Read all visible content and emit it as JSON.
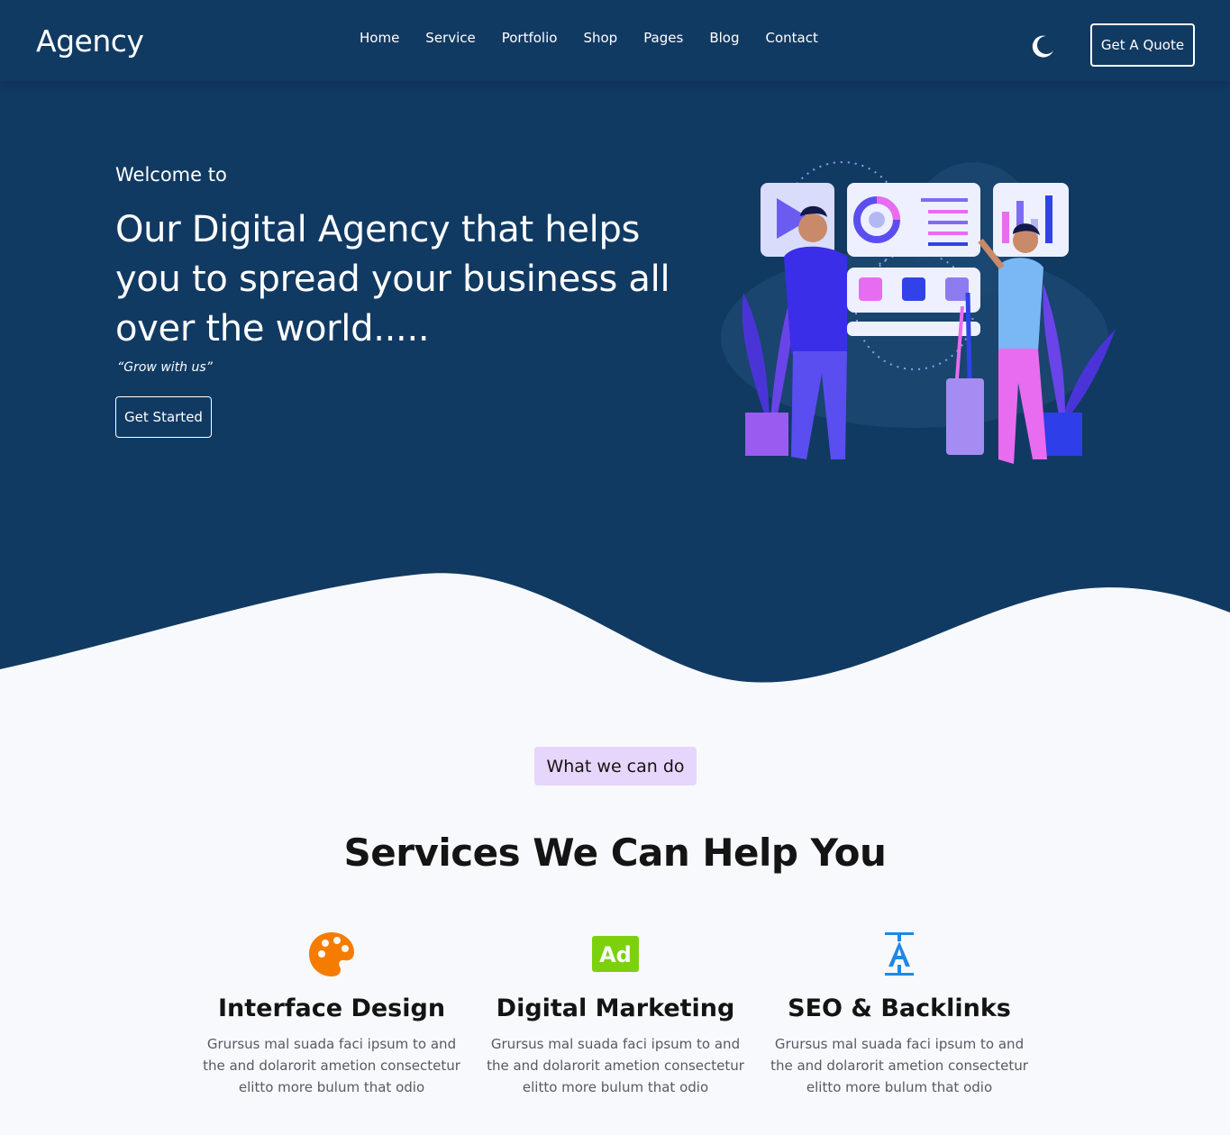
{
  "header": {
    "brand": "Agency",
    "nav": [
      "Home",
      "Service",
      "Portfolio",
      "Shop",
      "Pages",
      "Blog",
      "Contact"
    ],
    "theme_toggle_icon": "moon-icon",
    "cta_label": "Get A Quote"
  },
  "hero": {
    "welcome": "Welcome to",
    "headline": "Our Digital Agency that helps you to spread your business all over the world.....",
    "tagline": "“Grow with us”",
    "button_label": "Get Started",
    "illustration": "team-dashboard-illustration"
  },
  "services": {
    "badge": "What we can do",
    "title": "Services We Can Help You",
    "items": [
      {
        "icon": "palette-icon",
        "icon_color": "#f57c00",
        "title": "Interface Design",
        "description": "Grursus mal suada faci ipsum to and the and dolarorit ametion consectetur elitto more bulum that odio"
      },
      {
        "icon": "ad-icon",
        "icon_color": "#7cd10d",
        "icon_text": "Ad",
        "title": "Digital Marketing",
        "description": "Grursus mal suada faci ipsum to and the and dolarorit ametion consectetur elitto more bulum that odio"
      },
      {
        "icon": "seo-text-icon",
        "icon_color": "#1e88e5",
        "title": "SEO & Backlinks",
        "description": "Grursus mal suada faci ipsum to and the and dolarorit ametion consectetur elitto more bulum that odio"
      }
    ]
  },
  "colors": {
    "hero_bg": "#113a63",
    "page_bg": "#f8f9fc",
    "badge_bg": "#e7d6fb"
  }
}
